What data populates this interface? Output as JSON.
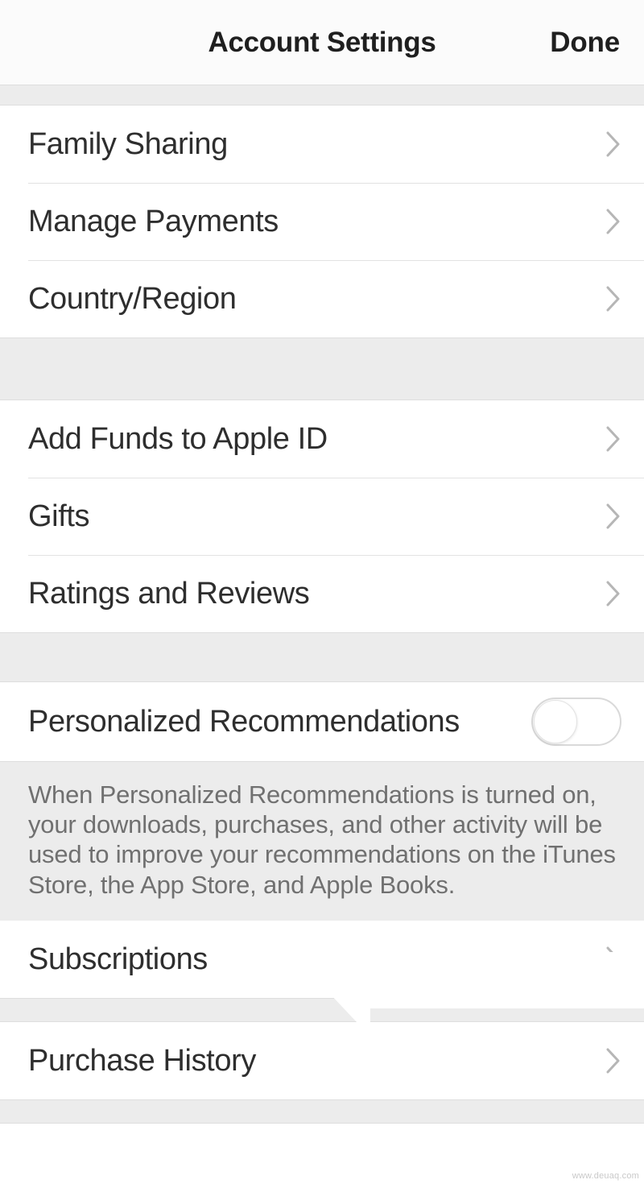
{
  "header": {
    "title": "Account Settings",
    "done_label": "Done"
  },
  "sections": {
    "group1": [
      {
        "label": "Family Sharing",
        "accessory": "chevron-right-icon"
      },
      {
        "label": "Manage Payments",
        "accessory": "chevron-right-icon"
      },
      {
        "label": "Country/Region",
        "accessory": "chevron-right-icon"
      }
    ],
    "group2": [
      {
        "label": "Add Funds to Apple ID",
        "accessory": "chevron-right-icon"
      },
      {
        "label": "Gifts",
        "accessory": "chevron-right-icon"
      },
      {
        "label": "Ratings and Reviews",
        "accessory": "chevron-right-icon"
      }
    ],
    "group3": {
      "toggle_label": "Personalized Recommendations",
      "toggle_state": "off",
      "footer_note": "When Personalized Recommendations is turned on, your downloads, purchases, and other activity will be used to improve your recommendations on the iTunes Store, the App Store, and Apple Books."
    },
    "group4": [
      {
        "label": "Subscriptions",
        "accessory": "chevron-right-icon"
      }
    ],
    "group5": [
      {
        "label": "Purchase History",
        "accessory": "chevron-right-icon"
      }
    ]
  },
  "annotation": {
    "arrow": "left-pointing-arrow",
    "points_at": "Subscriptions"
  },
  "watermark": {
    "text": "www.deuaq.com"
  },
  "colors": {
    "background": "#ffffff",
    "group_gap": "#ececec",
    "separator": "#e2e2e2",
    "primary_text": "#2e2e2e",
    "secondary_text": "#707070",
    "chevron": "#b6b6b6",
    "annotation": "#ffffff"
  }
}
